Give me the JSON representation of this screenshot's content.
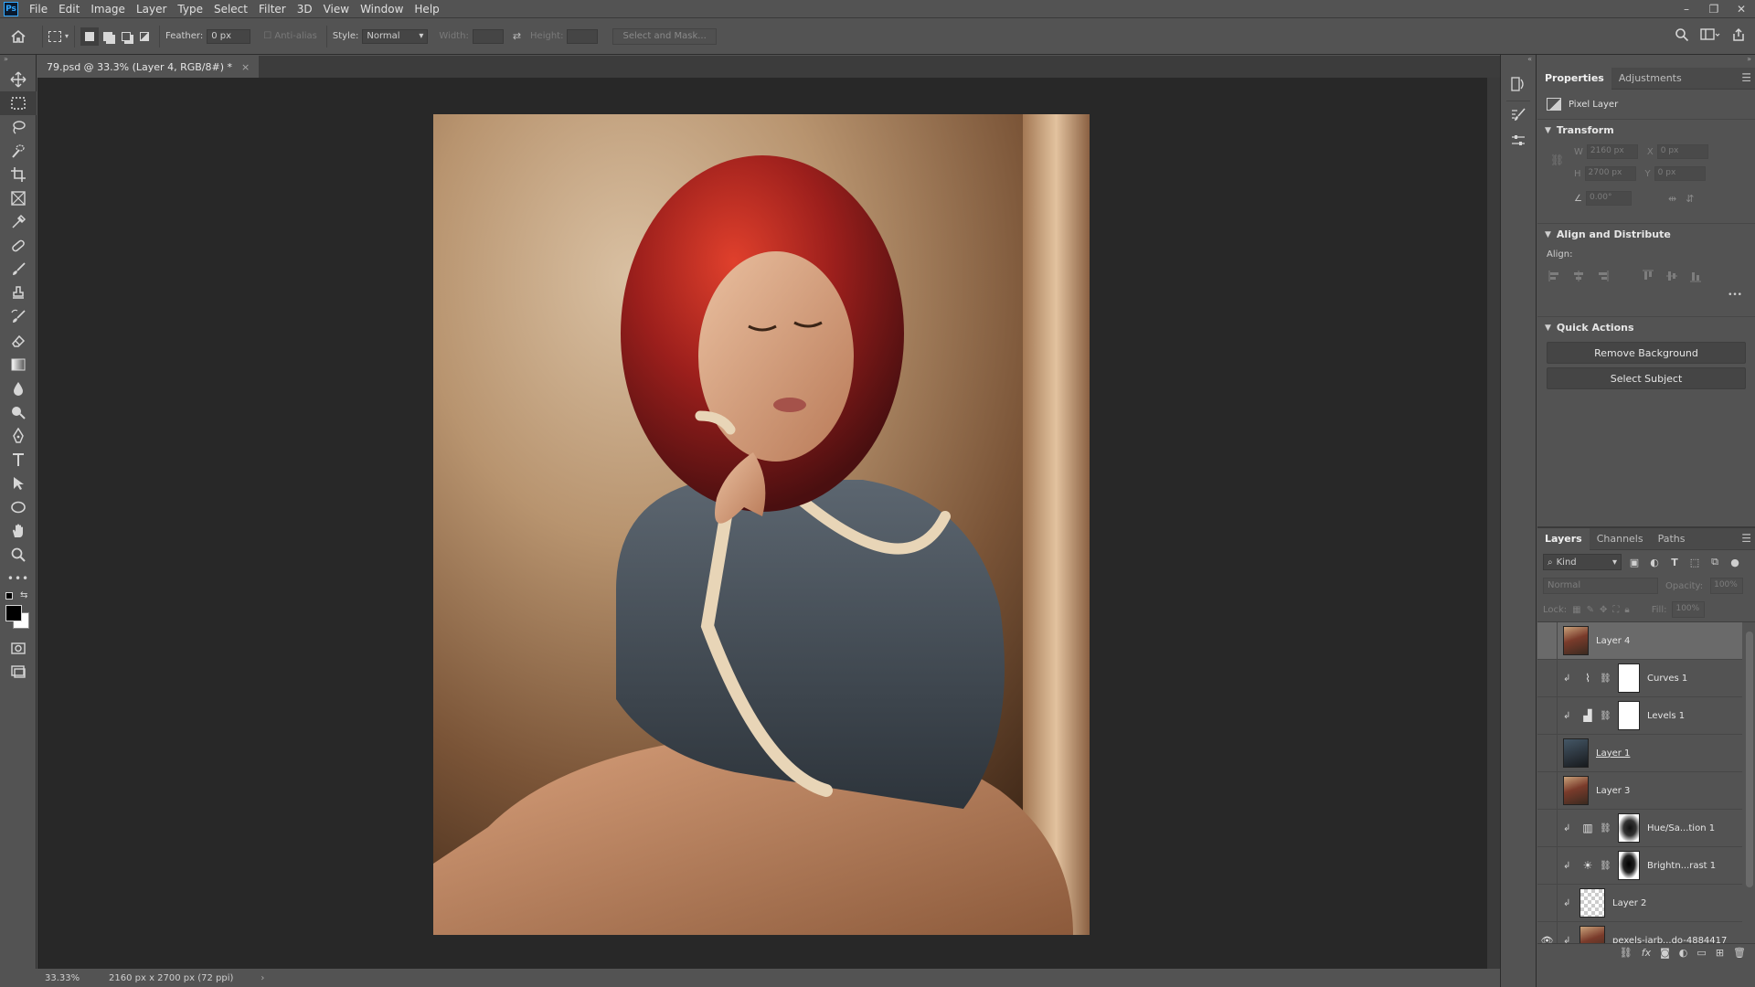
{
  "app": {
    "logo": "Ps",
    "menu": [
      "File",
      "Edit",
      "Image",
      "Layer",
      "Type",
      "Select",
      "Filter",
      "3D",
      "View",
      "Window",
      "Help"
    ],
    "window_controls": [
      "–",
      "❐",
      "✕"
    ]
  },
  "options": {
    "feather_label": "Feather:",
    "feather_value": "0 px",
    "antialias_label": "Anti-alias",
    "style_label": "Style:",
    "style_value": "Normal",
    "width_label": "Width:",
    "height_label": "Height:",
    "select_mask_label": "Select and Mask..."
  },
  "document": {
    "tab_title": "79.psd @ 33.3% (Layer 4, RGB/8#) *",
    "close": "×"
  },
  "status": {
    "zoom": "33.33%",
    "doc_info": "2160 px x 2700 px (72 ppi)",
    "arrow": "›"
  },
  "properties": {
    "tabs": [
      "Properties",
      "Adjustments"
    ],
    "layer_type": "Pixel Layer",
    "transform": {
      "header": "Transform",
      "w_label": "W",
      "w_value": "2160 px",
      "x_label": "X",
      "x_value": "0 px",
      "h_label": "H",
      "h_value": "2700 px",
      "y_label": "Y",
      "y_value": "0 px",
      "angle_value": "0.00°"
    },
    "align": {
      "header": "Align and Distribute",
      "label": "Align:",
      "more": "•••"
    },
    "quick_actions": {
      "header": "Quick Actions",
      "remove_bg": "Remove Background",
      "select_subject": "Select Subject"
    }
  },
  "layers_panel": {
    "tabs": [
      "Layers",
      "Channels",
      "Paths"
    ],
    "kind_label": "Kind",
    "blend_mode": "Normal",
    "opacity_label": "Opacity:",
    "opacity_value": "100%",
    "lock_label": "Lock:",
    "fill_label": "Fill:",
    "fill_value": "100%",
    "layers": [
      {
        "name": "Layer 4",
        "selected": true,
        "visible": false,
        "thumb": "photo",
        "clipped": false
      },
      {
        "name": "Curves 1",
        "selected": false,
        "visible": false,
        "thumb": "white",
        "adj": "curves",
        "clipped": true
      },
      {
        "name": "Levels 1",
        "selected": false,
        "visible": false,
        "thumb": "white",
        "adj": "levels",
        "clipped": true
      },
      {
        "name": "Layer 1",
        "selected": false,
        "visible": false,
        "thumb": "dark",
        "clipped": false
      },
      {
        "name": "Layer 3",
        "selected": false,
        "visible": false,
        "thumb": "photo",
        "clipped": false
      },
      {
        "name": "Hue/Sa...tion 1",
        "selected": false,
        "visible": false,
        "thumb": "mask-hue",
        "adj": "hue",
        "clipped": true
      },
      {
        "name": "Brightn...rast 1",
        "selected": false,
        "visible": false,
        "thumb": "mask-bright",
        "adj": "brightness",
        "clipped": true
      },
      {
        "name": "Layer 2",
        "selected": false,
        "visible": false,
        "thumb": "checker",
        "clipped": true
      },
      {
        "name": "pexels-jarb...do-4884417",
        "selected": false,
        "visible": true,
        "thumb": "photo",
        "clipped": true
      }
    ],
    "footer_icons": [
      "link-icon",
      "fx-icon",
      "mask-icon",
      "adjustment-icon",
      "folder-icon",
      "new-layer-icon",
      "trash-icon"
    ]
  }
}
